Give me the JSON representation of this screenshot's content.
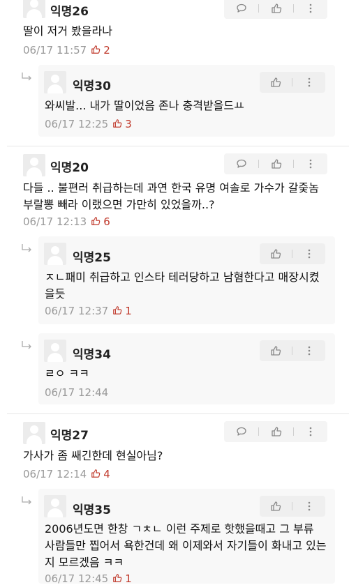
{
  "comments": [
    {
      "name": "익명26",
      "text": "딸이 저거 봤을라나",
      "time": "06/17 11:57",
      "likes": "2"
    },
    {
      "name": "익명30",
      "text": "와씨발... 내가 딸이었음 존나 충격받을드ㅛ",
      "time": "06/17 12:25",
      "likes": "3"
    },
    {
      "name": "익명20",
      "text": "다들 .. 불편러 취급하는데 과연 한국 유명 여솔로 가수가 갈줒놈 부랄뽕 빼라 이랬으면 가만히 있었을까..?",
      "time": "06/17 12:13",
      "likes": "6"
    },
    {
      "name": "익명25",
      "text": "ㅈㄴ패미 취급하고 인스타 테러당하고 남혐한다고 매장시켰을듯",
      "time": "06/17 12:37",
      "likes": "1"
    },
    {
      "name": "익명34",
      "text": "ㄹㅇ ㅋㅋ",
      "time": "06/17 12:44",
      "likes": ""
    },
    {
      "name": "익명27",
      "text": "가사가 좀 쌔긴한데 현실아님?",
      "time": "06/17 12:14",
      "likes": "4"
    },
    {
      "name": "익명35",
      "text": "2006년도면 한창 ㄱㅊㄴ 이런 주제로 핫했을때고 그 부류 사람들만 찝어서 욕한건데 왜 이제와서 자기들이 화내고 있는지 모르겠음 ㅋㅋ",
      "time": "06/17 12:45",
      "likes": "1"
    }
  ],
  "colors": {
    "like": "#c0392b",
    "meta": "#999999",
    "action_bg": "#f4f4f4",
    "reply_bg": "#f8f8f8"
  },
  "icons": {
    "comment": "speech-bubble-icon",
    "like": "thumbs-up-icon",
    "more": "vertical-dots-icon",
    "reply": "reply-arrow-icon"
  }
}
